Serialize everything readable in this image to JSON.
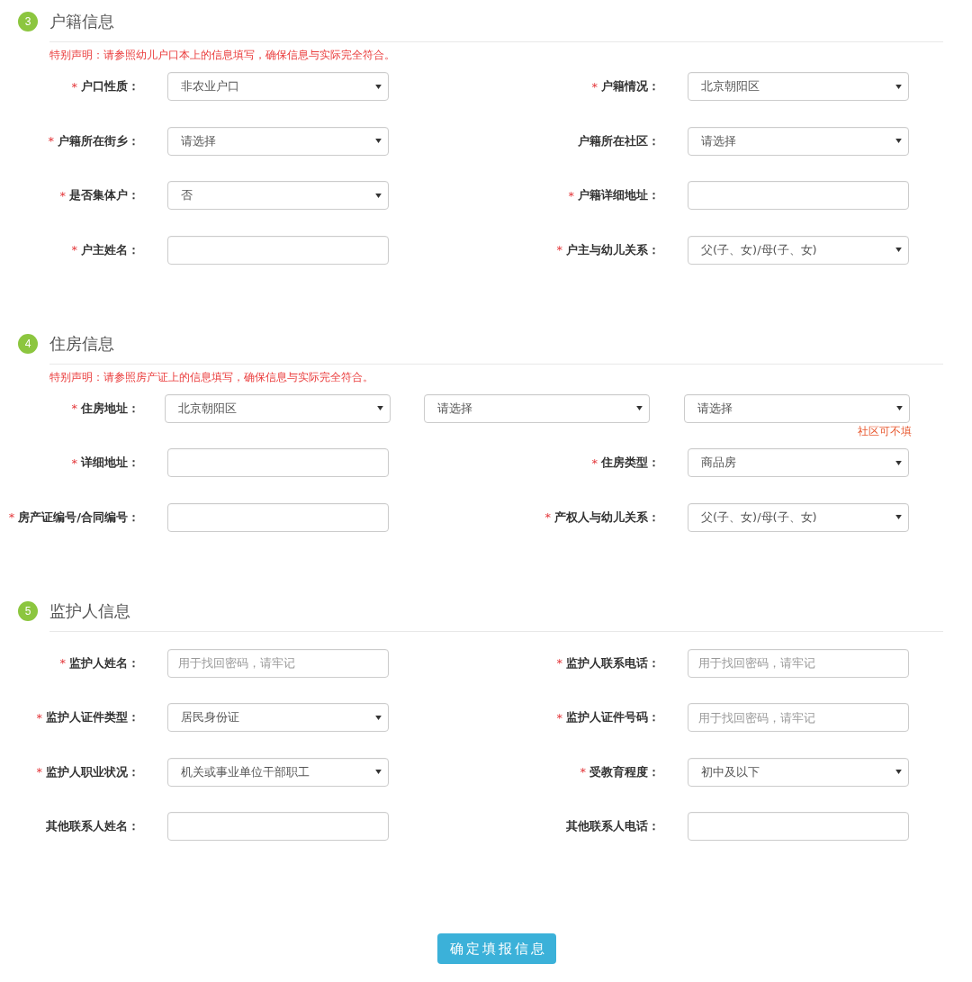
{
  "sections": [
    {
      "number": "3",
      "title": "户籍信息",
      "notice": "特别声明：请参照幼儿户口本上的信息填写，确保信息与实际完全符合。",
      "rows": [
        {
          "kind": "pair",
          "fields": [
            {
              "asterisk": "*",
              "label": "户口性质：",
              "kind": "select",
              "value": "非农业户口"
            },
            {
              "asterisk": "*",
              "label": "户籍情况：",
              "kind": "select",
              "value": "北京朝阳区"
            }
          ]
        },
        {
          "kind": "pair",
          "fields": [
            {
              "asterisk": "*",
              "label": "户籍所在街乡：",
              "kind": "select",
              "value": "请选择"
            },
            {
              "label": "户籍所在社区：",
              "kind": "select",
              "value": "请选择"
            }
          ]
        },
        {
          "kind": "pair",
          "fields": [
            {
              "asterisk": "*",
              "label": "是否集体户：",
              "kind": "select",
              "value": "否"
            },
            {
              "asterisk": "*",
              "label": "户籍详细地址：",
              "kind": "input"
            }
          ]
        },
        {
          "kind": "pair",
          "fields": [
            {
              "asterisk": "*",
              "label": "户主姓名：",
              "kind": "input"
            },
            {
              "asterisk": "*",
              "label": "户主与幼儿关系：",
              "kind": "select",
              "value": "父(子、女)/母(子、女)"
            }
          ]
        }
      ]
    },
    {
      "number": "4",
      "title": "住房信息",
      "notice": "特别声明：请参照房产证上的信息填写，确保信息与实际完全符合。",
      "rows": [
        {
          "kind": "address",
          "asterisk": "*",
          "label": "住房地址：",
          "selects": [
            {
              "value": "北京朝阳区"
            },
            {
              "value": "请选择"
            },
            {
              "value": "请选择"
            }
          ],
          "hint": "社区可不填"
        },
        {
          "kind": "pair",
          "fields": [
            {
              "asterisk": "*",
              "label": "详细地址：",
              "kind": "input"
            },
            {
              "asterisk": "*",
              "label": "住房类型：",
              "kind": "select",
              "value": "商品房"
            }
          ]
        },
        {
          "kind": "pair",
          "fields": [
            {
              "asterisk": "*",
              "label": "房产证编号/合同编号：",
              "kind": "input"
            },
            {
              "asterisk": "*",
              "label": "产权人与幼儿关系：",
              "kind": "select",
              "value": "父(子、女)/母(子、女)"
            }
          ]
        }
      ]
    },
    {
      "number": "5",
      "title": "监护人信息",
      "rows": [
        {
          "kind": "pair",
          "fields": [
            {
              "asterisk": "*",
              "label": "监护人姓名：",
              "kind": "input",
              "placeholder": "用于找回密码，请牢记"
            },
            {
              "asterisk": "*",
              "label": "监护人联系电话：",
              "kind": "input",
              "placeholder": "用于找回密码，请牢记"
            }
          ]
        },
        {
          "kind": "pair",
          "fields": [
            {
              "asterisk": "*",
              "label": "监护人证件类型：",
              "kind": "select",
              "value": "居民身份证"
            },
            {
              "asterisk": "*",
              "label": "监护人证件号码：",
              "kind": "input",
              "placeholder": "用于找回密码，请牢记"
            }
          ]
        },
        {
          "kind": "pair",
          "fields": [
            {
              "asterisk": "*",
              "label": "监护人职业状况：",
              "kind": "select",
              "value": "机关或事业单位干部职工"
            },
            {
              "asterisk": "*",
              "label": "受教育程度：",
              "kind": "select",
              "value": "初中及以下"
            }
          ]
        },
        {
          "kind": "pair",
          "fields": [
            {
              "label": "其他联系人姓名：",
              "kind": "input"
            },
            {
              "label": "其他联系人电话：",
              "kind": "input"
            }
          ]
        }
      ]
    }
  ],
  "submit_button": "确定填报信息"
}
